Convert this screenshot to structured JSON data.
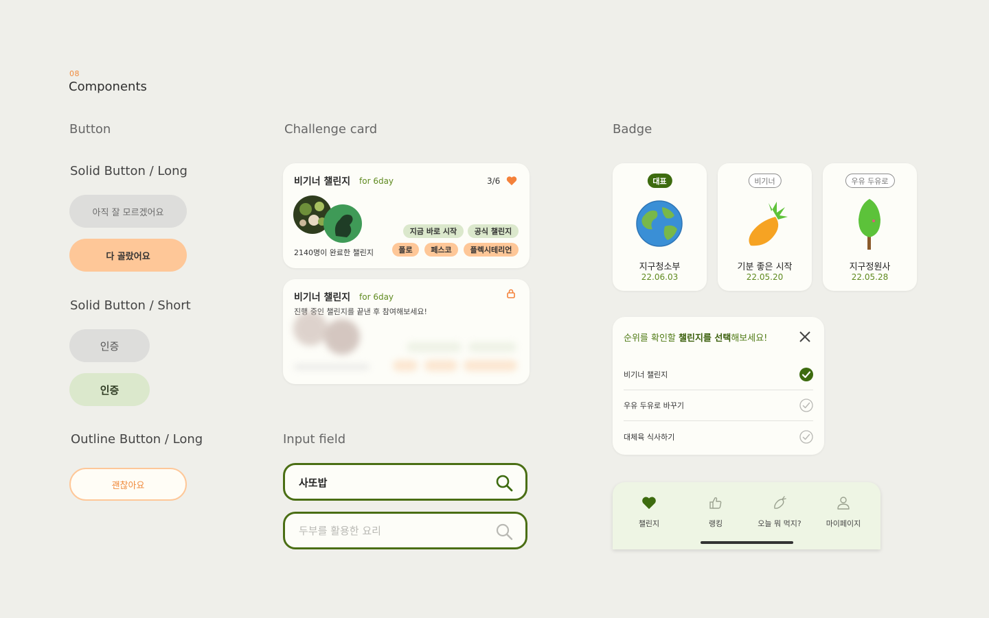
{
  "header": {
    "number": "08",
    "title": "Components"
  },
  "columns": {
    "button": "Button",
    "challenge_card": "Challenge card",
    "badge": "Badge",
    "input_field": "Input field"
  },
  "buttons": {
    "solid_long_title": "Solid Button / Long",
    "solid_long_gray": "아직 잘 모르겠어요",
    "solid_long_orange": "다 골랐어요",
    "solid_short_title": "Solid Button / Short",
    "solid_short_gray": "인증",
    "solid_short_green": "인증",
    "outline_long_title": "Outline Button / Long",
    "outline_long": "괜찮아요"
  },
  "challenge_cards": [
    {
      "title": "비기너 챌린지",
      "subtitle": "for 6day",
      "count": "3/6",
      "completed": "2140명이 완료한 챌린지",
      "tags_green": [
        "지금 바로 시작",
        "공식 챌린지"
      ],
      "tags_orange": [
        "폴로",
        "페스코",
        "플렉시테리언"
      ],
      "heart_color": "#f4813a"
    },
    {
      "title": "비기너 챌린지",
      "subtitle": "for 6day",
      "description": "진행 중인 챌린지를 끝낸 후 참여해보세요!",
      "locked": true,
      "lock_color": "#f4813a"
    }
  ],
  "badges": [
    {
      "pill": "대표",
      "name": "지구청소부",
      "date": "22.06.03",
      "icon": "earth-icon"
    },
    {
      "pill": "비기너",
      "name": "기분 좋은 시작",
      "date": "22.05.20",
      "icon": "carrot-icon"
    },
    {
      "pill": "우유 두유로",
      "name": "지구정원사",
      "date": "22.05.28",
      "icon": "tree-icon"
    }
  ],
  "modal": {
    "title_part1": "순위를 확인할 ",
    "title_part2": "챌린지를 선택",
    "title_part3": "해보세요!",
    "options": [
      {
        "label": "비기너 챌린지",
        "checked": true
      },
      {
        "label": "우유 두유로 바꾸기",
        "checked": false
      },
      {
        "label": "대체육 식사하기",
        "checked": false
      }
    ]
  },
  "inputs": [
    {
      "value": "사또밥",
      "placeholder": ""
    },
    {
      "value": "",
      "placeholder": "두부를 활용한 요리"
    }
  ],
  "nav": {
    "items": [
      {
        "label": "챌린지",
        "icon": "heart-icon",
        "active": true
      },
      {
        "label": "랭킹",
        "icon": "thumbs-up-icon",
        "active": false
      },
      {
        "label": "오늘 뭐 먹지?",
        "icon": "carrot-outline-icon",
        "active": false
      },
      {
        "label": "마이페이지",
        "icon": "person-icon",
        "active": false
      }
    ]
  },
  "colors": {
    "background": "#efefea",
    "accent_orange": "#fec798",
    "accent_green": "#3d6b0f",
    "nav_bg": "#eef5e4"
  }
}
